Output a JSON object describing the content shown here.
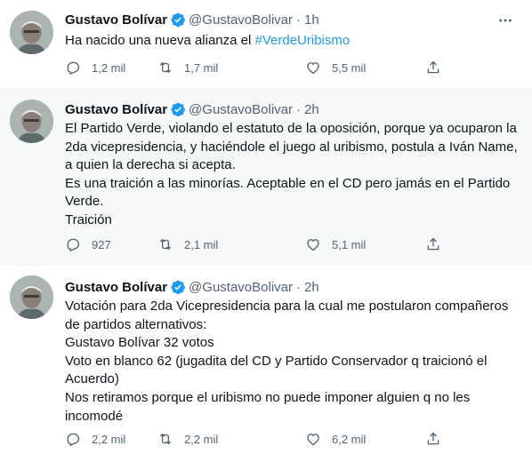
{
  "tweets": [
    {
      "author": {
        "name": "Gustavo Bolívar",
        "handle": "@GustavoBolivar"
      },
      "time": "1h",
      "separator": "·",
      "text_lines": [
        "Ha nacido una nueva alianza el "
      ],
      "hashtag": "#VerdeUribismo",
      "stats": {
        "replies": "1,2 mil",
        "retweets": "1,7 mil",
        "likes": "5,5 mil"
      }
    },
    {
      "author": {
        "name": "Gustavo Bolívar",
        "handle": "@GustavoBolivar"
      },
      "time": "2h",
      "separator": "·",
      "text_lines": [
        "El Partido Verde, violando el estatuto de la oposición, porque ya ocuparon la",
        "2da vicepresidencia, y haciéndole el juego al uribismo, postula a Iván Name,",
        "a quien la derecha si acepta.",
        "Es una traición a las minorías. Aceptable en el CD pero jamás en el Partido",
        "Verde.",
        "Traición"
      ],
      "stats": {
        "replies": "927",
        "retweets": "2,1 mil",
        "likes": "5,1 mil"
      }
    },
    {
      "author": {
        "name": "Gustavo Bolívar",
        "handle": "@GustavoBolivar"
      },
      "time": "2h",
      "separator": "·",
      "text_lines": [
        "Votación para 2da Vicepresidencia para la cual me postularon compañeros",
        "de partidos alternativos:",
        "Gustavo Bolívar 32 votos",
        "Voto en blanco 62 (jugadita del CD y Partido Conservador q traicionó el",
        "Acuerdo)",
        "Nos retiramos porque el uribismo no puede imponer alguien q no les",
        "incomodé"
      ],
      "stats": {
        "replies": "2,2 mil",
        "retweets": "2,2 mil",
        "likes": "6,2 mil"
      }
    }
  ],
  "icons": {
    "verified": "verified-badge-icon",
    "more": "more-icon",
    "reply": "reply-icon",
    "retweet": "retweet-icon",
    "like": "like-icon",
    "share": "share-icon"
  },
  "colors": {
    "accent": "#1d9bf0",
    "muted": "#536471",
    "highlight": "#f7f9f9",
    "text": "#0f1419"
  }
}
